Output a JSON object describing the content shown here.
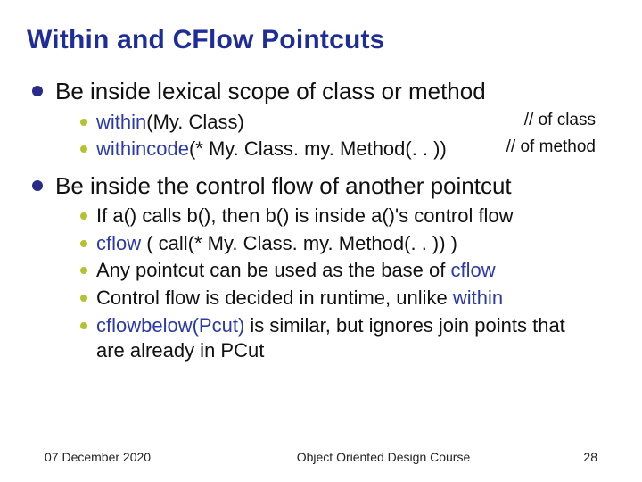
{
  "slide": {
    "title": "Within and CFlow Pointcuts",
    "point1": {
      "heading": "Be inside lexical scope of class or method",
      "rowA": {
        "kw": "within",
        "code": "(My. Class)",
        "comment": "// of class"
      },
      "rowB": {
        "kw": "withincode",
        "code": "(* My. Class. my. Method(. . ))",
        "comment": "// of method"
      }
    },
    "point2": {
      "heading": "Be inside the control flow of another pointcut",
      "i1": "If a() calls b(), then b() is inside a()'s control flow",
      "i2": {
        "kw": "cflow",
        "rest": " ( call(* My. Class. my. Method(. . )) )"
      },
      "i3": {
        "pre": "Any pointcut can be used as the base of ",
        "kw": "cflow"
      },
      "i4": {
        "pre": "Control flow is decided in runtime, unlike ",
        "kw": "within"
      },
      "i5": {
        "kw": "cflowbelow(Pcut)",
        "rest": " is similar, but ignores join points that are already in PCut"
      }
    }
  },
  "footer": {
    "date": "07 December 2020",
    "course": "Object Oriented Design Course",
    "page": "28"
  }
}
